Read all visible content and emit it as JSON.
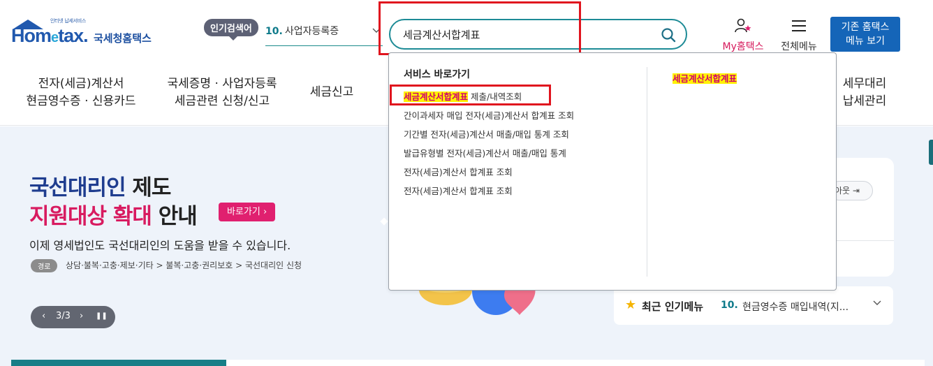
{
  "logo": {
    "small_text": "인터넷 납세서비스",
    "main_text": "Hom",
    "main_e": "e",
    "main_tax": "tax.",
    "sub_text": "국세청홈택스"
  },
  "header": {
    "popular_badge": "인기검색어",
    "popular_rank_num": "10.",
    "popular_rank_text": "사업자등록증",
    "search_value": "세금계산서합계표",
    "my_hometax": "My홈택스",
    "all_menu": "전체메뉴",
    "old_hometax_line1": "기존 홈택스",
    "old_hometax_line2": "메뉴 보기"
  },
  "gnb": [
    {
      "line1": "전자(세금)계산서",
      "line2": "현금영수증 · 신용카드"
    },
    {
      "line1": "국세증명 · 사업자등록",
      "line2": "세금관련 신청/신고"
    },
    {
      "line1": "세금신고",
      "line2": ""
    },
    {
      "line1": "세무대리",
      "line2": "납세관리"
    }
  ],
  "hero": {
    "line1_blue": "국선대리인",
    "line1_rest": " 제도",
    "line2_pink": "지원대상 확대",
    "line2_rest": " 안내",
    "go_button": "바로가기 ›",
    "description": "이제 영세법인도 국선대리인의 도움을 받을 수 있습니다.",
    "path_badge": "경로",
    "path_text": "상담·불복·고충·제보·기타 > 불복·고충·권리보호 > 국선대리인 신청",
    "slider": {
      "prev": "‹",
      "counter": "3/3",
      "next": "›",
      "pause": "❚❚"
    }
  },
  "login_panel": {
    "logout": "아웃 ⇥"
  },
  "popular_menu": {
    "title": "최근 인기메뉴",
    "num": "10.",
    "text": "현금영수증 매입내역(지..."
  },
  "dropdown": {
    "title": "서비스 바로가기",
    "items": [
      {
        "highlight": "세금계산서합계표",
        "rest": " 제출/내역조회"
      },
      {
        "highlight": "",
        "rest": "간이과세자 매입 전자(세금)계산서 합계표 조회"
      },
      {
        "highlight": "",
        "rest": "기간별 전자(세금)계산서 매출/매입 통계 조회"
      },
      {
        "highlight": "",
        "rest": "발급유형별 전자(세금)계산서 매출/매입 통계"
      },
      {
        "highlight": "",
        "rest": "전자(세금)계산서 합계표 조회"
      },
      {
        "highlight": "",
        "rest": "전자(세금)계산서 합계표 조회"
      }
    ],
    "right_item": "세금계산서합계표"
  },
  "colors": {
    "accent_teal": "#1d8b96",
    "brand_blue": "#1565b8",
    "pink": "#d81b60",
    "highlight": "#fff200",
    "annotation_red": "#e0141e"
  }
}
